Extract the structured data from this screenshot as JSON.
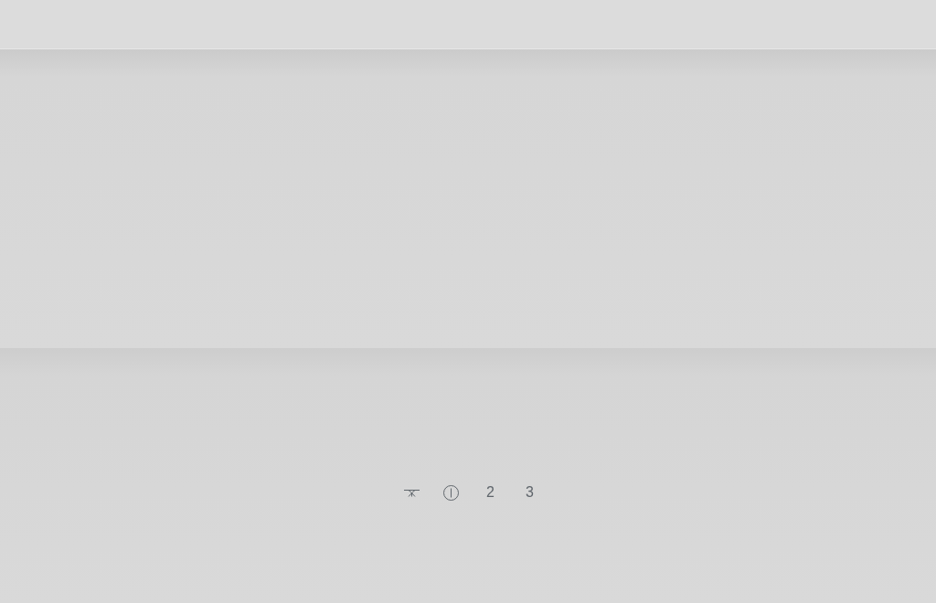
{
  "controls": [
    {
      "kind": "light"
    },
    {
      "kind": "power"
    },
    {
      "kind": "speed",
      "label": "2"
    },
    {
      "kind": "speed",
      "label": "3"
    }
  ]
}
